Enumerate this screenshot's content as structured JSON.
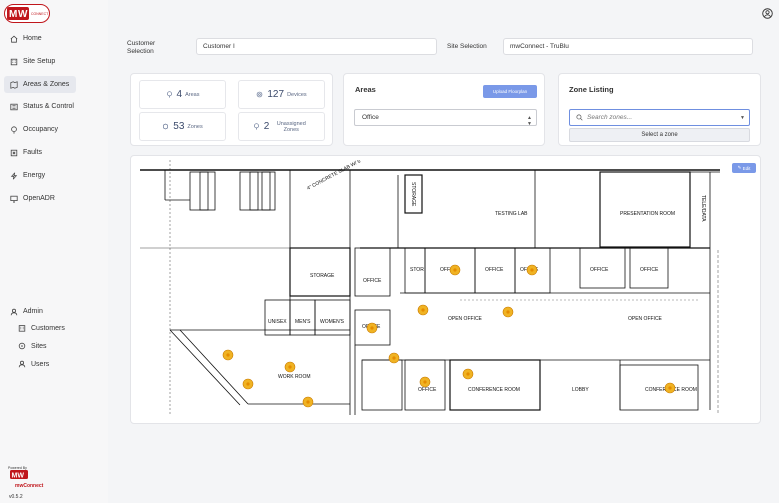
{
  "brand": {
    "logo_text": "mwCONNECT",
    "accent": "#c0161c",
    "primary": "#7a99e8"
  },
  "sidebar": {
    "items": [
      {
        "label": "Home",
        "icon": "home-icon"
      },
      {
        "label": "Site Setup",
        "icon": "building-icon"
      },
      {
        "label": "Areas & Zones",
        "icon": "map-pin-icon",
        "active": true
      },
      {
        "label": "Status & Control",
        "icon": "sliders-icon"
      },
      {
        "label": "Occupancy",
        "icon": "location-icon"
      },
      {
        "label": "Faults",
        "icon": "faults-icon"
      },
      {
        "label": "Energy",
        "icon": "bolt-icon"
      },
      {
        "label": "OpenADR",
        "icon": "monitor-icon"
      }
    ],
    "admin": {
      "label": "Admin",
      "items": [
        {
          "label": "Customers",
          "icon": "customers-icon"
        },
        {
          "label": "Sites",
          "icon": "sites-icon"
        },
        {
          "label": "Users",
          "icon": "users-icon"
        }
      ]
    },
    "footer": {
      "powered_by": "Powered By",
      "product": "mwConnect",
      "version": "v0.5.2"
    }
  },
  "header": {
    "customer_label": "Customer Selection",
    "customer_value": "Customer I",
    "site_label": "Site Selection",
    "site_value": "mwConnect - TruBlu"
  },
  "stats": {
    "areas": {
      "value": "4",
      "label": "Areas"
    },
    "devices": {
      "value": "127",
      "label": "Devices"
    },
    "zones": {
      "value": "53",
      "label": "Zones"
    },
    "unassigned": {
      "value": "2",
      "label": "Unassigned Zones"
    }
  },
  "areas_card": {
    "title": "Areas",
    "upload_label": "Upload Floorplan",
    "selected": "Office"
  },
  "zone_card": {
    "title": "Zone Listing",
    "search_placeholder": "Search zones...",
    "select_button": "Select a zone"
  },
  "floorplan": {
    "edit_label": "Edit",
    "rooms": {
      "storage_small": "STORAGE",
      "testing_lab": "TESTING LAB",
      "presentation_room": "PRESENTATION ROOM",
      "tele_data": "TELE/DATA",
      "storage": "STORAGE",
      "office_1": "OFFICE",
      "stor": "STOR",
      "office_2": "OFFICE",
      "office_3": "OFFICE",
      "office_4": "OFFICE",
      "office_5": "OFFICE",
      "office_6": "OFFICE",
      "unisex": "UNISEX",
      "mens": "MEN'S",
      "womens": "WOMEN'S",
      "office_7": "OFFICE",
      "open_office_1": "OPEN OFFICE",
      "open_office_2": "OPEN OFFICE",
      "work_room": "WORK ROOM",
      "office_8": "OFFICE",
      "conference_room_1": "CONFERENCE ROOM",
      "lobby": "LOBBY",
      "conference_room_2": "CONFERENCE ROOM",
      "office_9": "OFFICE"
    },
    "note": "4\" CONCRETE SLAB W/ 6\" WIRE AT 6\" O.C. ON 15 MIL VAPOR BARRIER ON 6\" COMPACTED FILL TYP. THROUGHOUT BUILDING"
  }
}
